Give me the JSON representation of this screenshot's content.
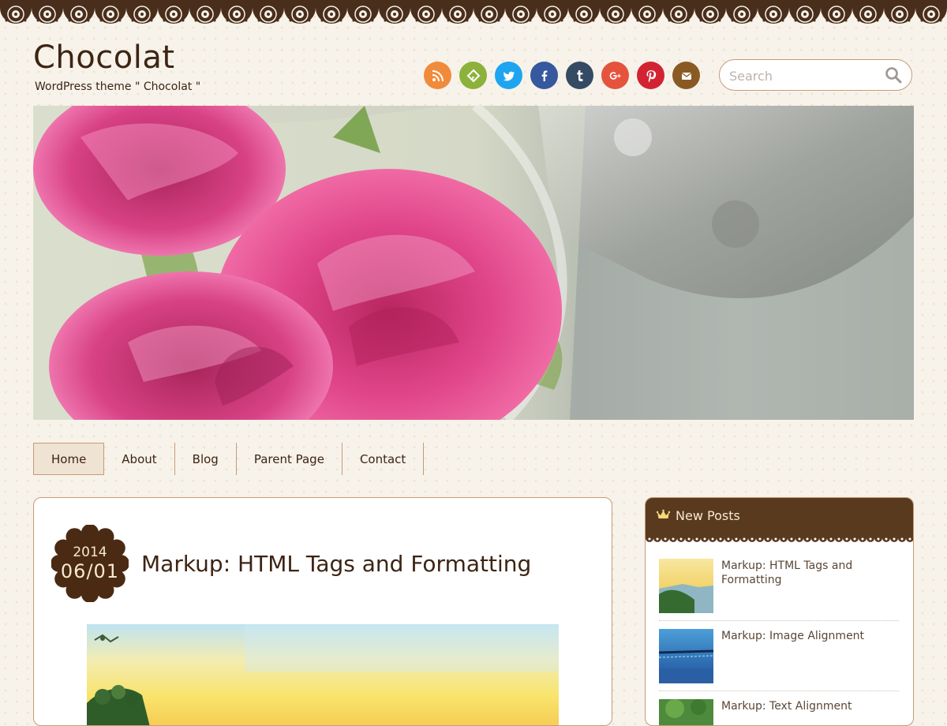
{
  "site": {
    "title": "Chocolat",
    "tagline": "WordPress theme \" Chocolat \""
  },
  "social": [
    {
      "name": "rss",
      "color": "#f08b3b"
    },
    {
      "name": "feedly",
      "color": "#8cb23b"
    },
    {
      "name": "twitter",
      "color": "#1fa5f0"
    },
    {
      "name": "facebook",
      "color": "#35589e"
    },
    {
      "name": "tumblr",
      "color": "#354a63"
    },
    {
      "name": "google-plus",
      "color": "#e5533d"
    },
    {
      "name": "pinterest",
      "color": "#d22333"
    },
    {
      "name": "mail",
      "color": "#8a5a24"
    }
  ],
  "search": {
    "placeholder": "Search"
  },
  "nav": {
    "items": [
      {
        "label": "Home",
        "active": true
      },
      {
        "label": "About"
      },
      {
        "label": "Blog"
      },
      {
        "label": "Parent Page"
      },
      {
        "label": "Contact"
      }
    ]
  },
  "post": {
    "date_year": "2014",
    "date_day": "06/01",
    "title": "Markup: HTML Tags and Formatting"
  },
  "sidebar": {
    "widget_title": "New Posts",
    "posts": [
      {
        "title": "Markup: HTML Tags and Formatting"
      },
      {
        "title": "Markup: Image Alignment"
      },
      {
        "title": "Markup: Text Alignment"
      }
    ]
  },
  "colors": {
    "brand_brown": "#4a2e1c",
    "border": "#c89b78",
    "page_bg": "#f7f3ea",
    "nav_active_bg": "#efe3d3"
  }
}
